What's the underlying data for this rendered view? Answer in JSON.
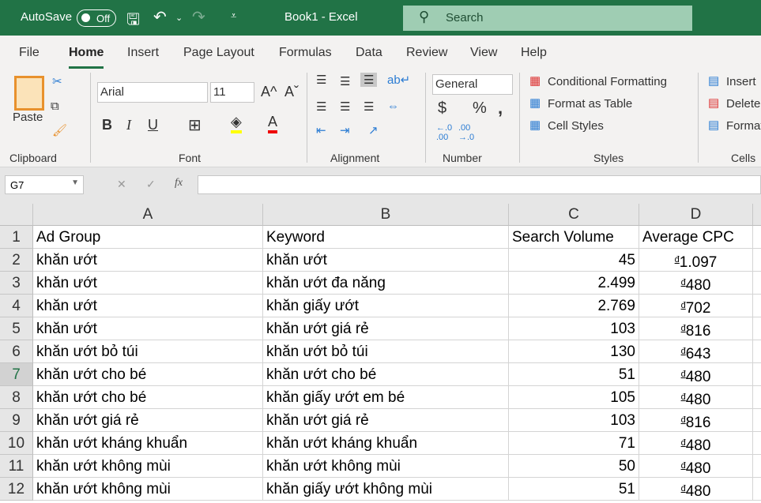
{
  "title": {
    "autosave": "AutoSave",
    "toggle": "Off",
    "doc": "Book1  -  Excel",
    "search": "Search"
  },
  "tabs": [
    "File",
    "Home",
    "Insert",
    "Page Layout",
    "Formulas",
    "Data",
    "Review",
    "View",
    "Help"
  ],
  "ribbon": {
    "paste": "Paste",
    "font": "Arial",
    "size": "11",
    "number_format": "General",
    "conditional": "Conditional Formatting",
    "format_table": "Format as Table",
    "cell_styles": "Cell Styles",
    "insert": "Insert",
    "delete": "Delete",
    "format": "Format",
    "groups": [
      "Clipboard",
      "Font",
      "Alignment",
      "Number",
      "Styles",
      "Cells"
    ]
  },
  "formula_bar": {
    "name_box": "G7",
    "fx": "fx",
    "value": ""
  },
  "columns": [
    "A",
    "B",
    "C",
    "D"
  ],
  "selected_row": 7,
  "rows": [
    [
      "1",
      "Ad Group",
      "Keyword",
      "Search Volume",
      "Average CPC",
      ""
    ],
    [
      "2",
      "khăn ướt",
      "khăn ướt",
      "45",
      "1.097",
      "đ"
    ],
    [
      "3",
      "khăn ướt",
      "khăn ướt đa năng",
      "2.499",
      "480",
      "đ"
    ],
    [
      "4",
      "khăn ướt",
      "khăn giấy ướt",
      "2.769",
      "702",
      "đ"
    ],
    [
      "5",
      "khăn ướt",
      "khăn ướt giá rẻ",
      "103",
      "816",
      "đ"
    ],
    [
      "6",
      "khăn ướt bỏ túi",
      "khăn ướt bỏ túi",
      "130",
      "643",
      "đ"
    ],
    [
      "7",
      "khăn ướt cho bé",
      "khăn ướt cho bé",
      "51",
      "480",
      "đ"
    ],
    [
      "8",
      "khăn ướt cho bé",
      "khăn giấy ướt em bé",
      "105",
      "480",
      "đ"
    ],
    [
      "9",
      "khăn ướt giá rẻ",
      "khăn ướt giá rẻ",
      "103",
      "816",
      "đ"
    ],
    [
      "10",
      "khăn ướt kháng khuẩn",
      "khăn ướt kháng khuẩn",
      "71",
      "480",
      "đ"
    ],
    [
      "11",
      "khăn ướt không mùi",
      "khăn ướt không mùi",
      "50",
      "480",
      "đ"
    ],
    [
      "12",
      "khăn ướt không mùi",
      "khăn giấy ướt không mùi",
      "51",
      "480",
      "đ"
    ]
  ],
  "colors": {
    "brand": "#217346",
    "search_bg": "#9fcdb3"
  }
}
